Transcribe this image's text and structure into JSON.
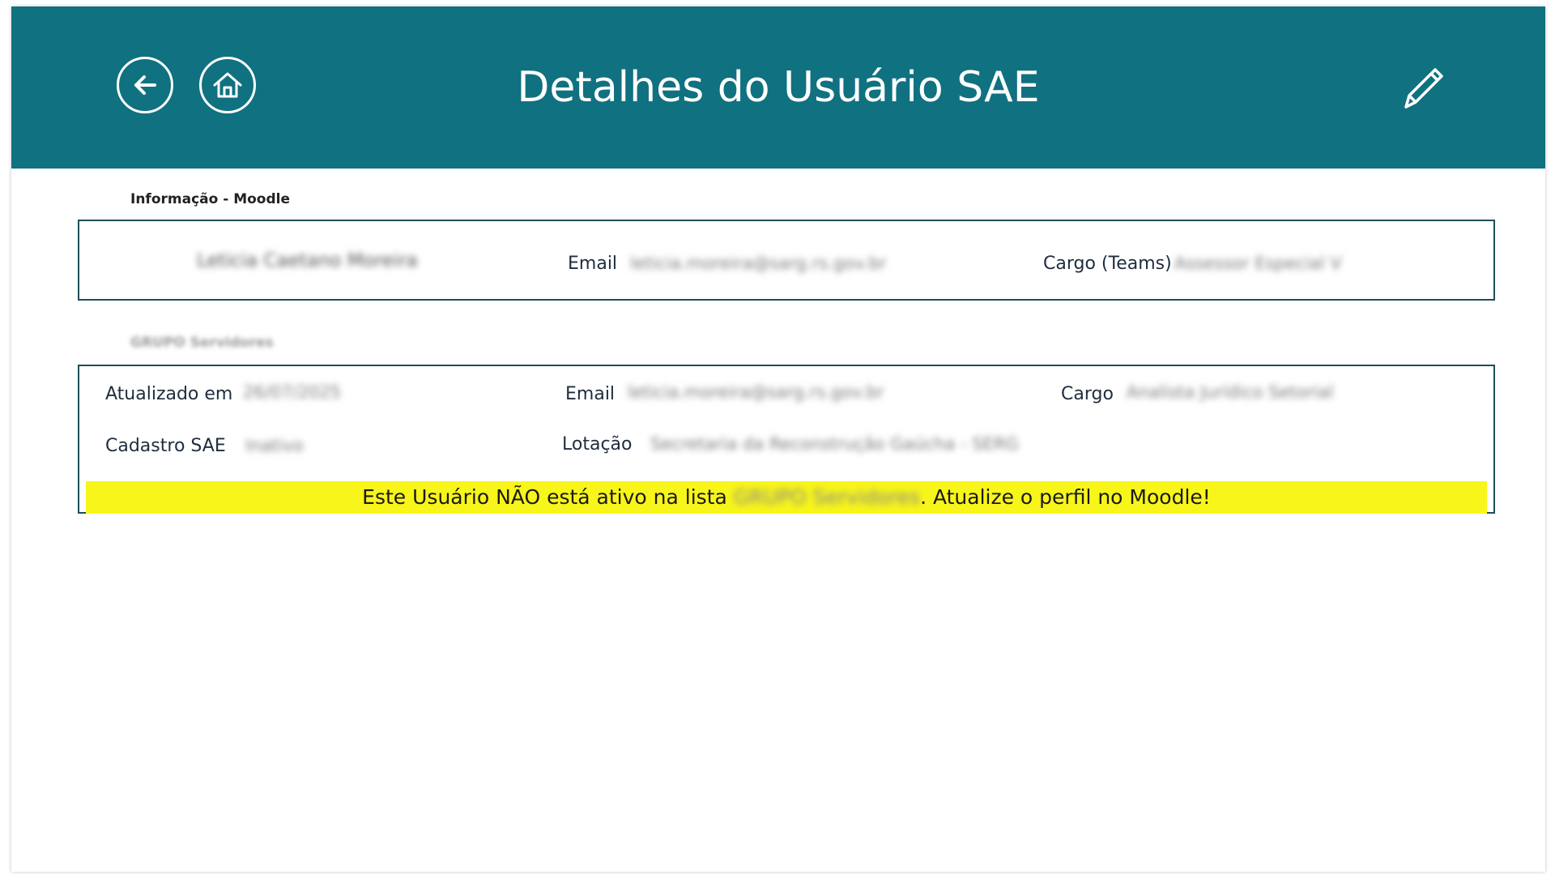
{
  "header": {
    "title": "Detalhes do Usuário SAE",
    "back_icon": "back-arrow-icon",
    "home_icon": "home-icon",
    "edit_icon": "pencil-icon",
    "background_color": "#107180"
  },
  "moodle_section": {
    "label": "Informação - Moodle",
    "name_value": "Leticia Caetano Moreira",
    "email_label": "Email",
    "email_value": "leticia.moreira@sarg.rs.gov.br",
    "cargo_label": "Cargo (Teams)",
    "cargo_value": "Assessor Especial V"
  },
  "group_section": {
    "label": "GRUPO Servidores",
    "updated_label": "Atualizado em",
    "updated_value": "26/07/2025",
    "email_label": "Email",
    "email_value": "leticia.moreira@sarg.rs.gov.br",
    "cargo_label": "Cargo",
    "cargo_value": "Analista Jurídico Setorial",
    "cadastro_label": "Cadastro SAE",
    "cadastro_value": "Inativo",
    "lotacao_label": "Lotação",
    "lotacao_value": "Secretaria da Reconstrução Gaúcha - SERG"
  },
  "warning": {
    "prefix": "Este Usuário NÃO está ativo na lista ",
    "group_name": "GRUPO Servidores",
    "suffix": ". Atualize o perfil no Moodle!",
    "background_color": "#f8f51a"
  }
}
